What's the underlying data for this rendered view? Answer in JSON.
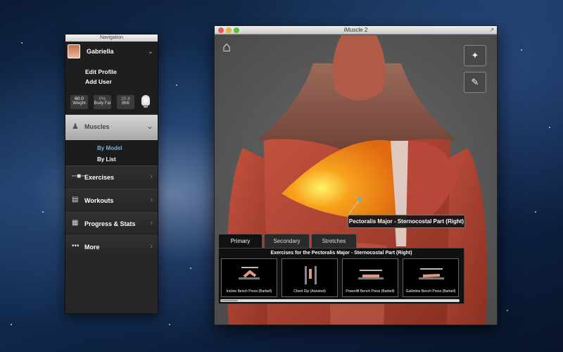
{
  "navigation": {
    "title": "Navigation",
    "profile": {
      "name": "Gabriella",
      "edit_profile": "Edit Profile",
      "add_user": "Add User",
      "stats": [
        {
          "value": "60.0",
          "label": "Weight"
        },
        {
          "value": "0%",
          "label": "Body Fat"
        },
        {
          "value": "20.8",
          "label": "BMI"
        }
      ]
    },
    "muscles": {
      "label": "Muscles",
      "sub_items": [
        "By Model",
        "By List"
      ]
    },
    "items": [
      {
        "label": "Exercises",
        "icon": "dumbbell-icon"
      },
      {
        "label": "Workouts",
        "icon": "clipboard-icon"
      },
      {
        "label": "Progress & Stats",
        "icon": "calendar-icon"
      },
      {
        "label": "More",
        "icon": "more-dots-icon"
      }
    ]
  },
  "window": {
    "title": "iMuscle 2",
    "muscle_label": "Pectoralis Major - Sternocostal Part (Right)",
    "tabs": [
      "Primary",
      "Secondary",
      "Stretches"
    ],
    "exercises_heading": "Exercises for the Pectoralis Major - Sternocostal Part (Right)",
    "exercises": [
      "Incline Bench Press (Barbell)",
      "Chest Dip (Assisted)",
      "Powerlift Bench Press (Barbell)",
      "Guillotine Bench Press (Barbell)"
    ]
  },
  "colors": {
    "highlight_muscle": "#f39a1c",
    "active_sub_item": "#7aaee8",
    "muscle_red": "#a8402f"
  }
}
